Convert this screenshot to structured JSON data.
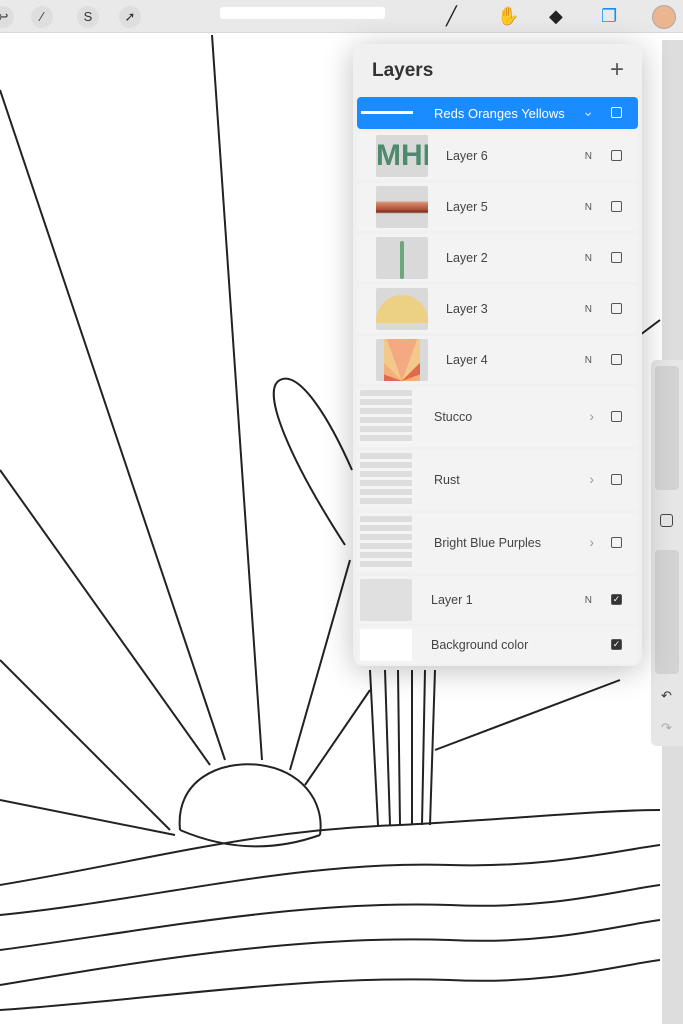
{
  "toolbar": {
    "left_tools": [
      "adjust-icon",
      "magic-wand-icon",
      "selection-icon",
      "transform-icon"
    ],
    "right_tools": [
      "brush-icon",
      "smudge-icon",
      "eraser-icon",
      "layers-icon"
    ],
    "active_tool": "layers",
    "current_color": "#eab58f"
  },
  "layers_panel": {
    "title": "Layers",
    "add_label": "+",
    "group": {
      "name": "Reds Oranges Yellows",
      "expanded": true,
      "visible": false
    },
    "layers": [
      {
        "name": "Layer 6",
        "mode": "N",
        "visible": false
      },
      {
        "name": "Layer 5",
        "mode": "N",
        "visible": false
      },
      {
        "name": "Layer 2",
        "mode": "N",
        "visible": false
      },
      {
        "name": "Layer 3",
        "mode": "N",
        "visible": false
      },
      {
        "name": "Layer 4",
        "mode": "N",
        "visible": false
      }
    ],
    "groups": [
      {
        "name": "Stucco",
        "visible": false
      },
      {
        "name": "Rust",
        "visible": false
      },
      {
        "name": "Bright Blue Purples",
        "visible": false
      }
    ],
    "layer1": {
      "name": "Layer 1",
      "mode": "N",
      "visible": true
    },
    "background": {
      "name": "Background color",
      "visible": true
    },
    "thumb_text": "MHF"
  },
  "accent": "#1a8cff"
}
